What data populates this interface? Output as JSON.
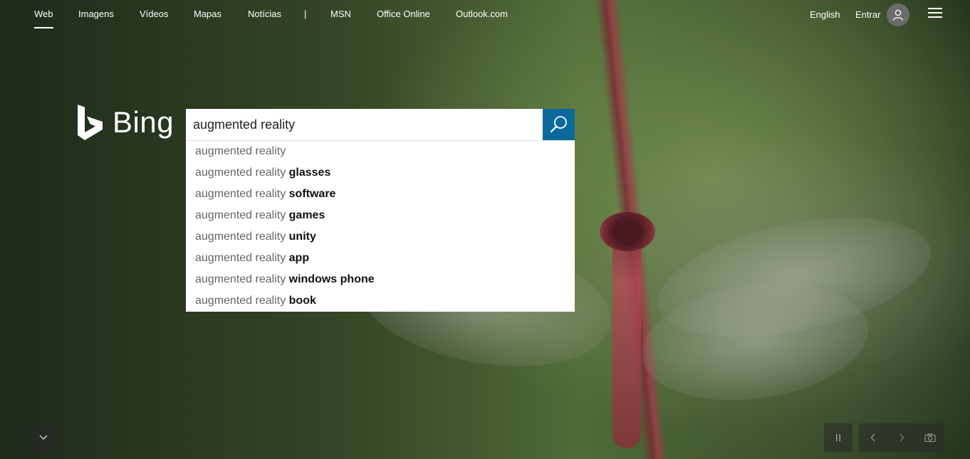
{
  "nav": {
    "items": [
      {
        "label": "Web",
        "active": true
      },
      {
        "label": "Imagens"
      },
      {
        "label": "Vídeos"
      },
      {
        "label": "Mapas"
      },
      {
        "label": "Notícias"
      },
      {
        "label": "|"
      },
      {
        "label": "MSN"
      },
      {
        "label": "Office Online"
      },
      {
        "label": "Outlook.com"
      }
    ],
    "language": "English",
    "signin": "Entrar"
  },
  "logo": {
    "text": "Bing"
  },
  "search": {
    "value": "augmented reality",
    "suggestions": [
      {
        "prefix": "augmented reality",
        "suffix": ""
      },
      {
        "prefix": "augmented reality",
        "suffix": "glasses"
      },
      {
        "prefix": "augmented reality",
        "suffix": "software"
      },
      {
        "prefix": "augmented reality",
        "suffix": "games"
      },
      {
        "prefix": "augmented reality",
        "suffix": "unity"
      },
      {
        "prefix": "augmented reality",
        "suffix": "app"
      },
      {
        "prefix": "augmented reality",
        "suffix": "windows phone"
      },
      {
        "prefix": "augmented reality",
        "suffix": "book"
      }
    ]
  },
  "icons": {
    "search": "search-icon",
    "avatar": "user-icon",
    "menu": "hamburger-menu-icon",
    "scroll": "chevron-down-icon",
    "pause": "pause-icon",
    "prev": "chevron-left-icon",
    "next": "chevron-right-icon",
    "camera": "camera-icon"
  },
  "colors": {
    "search_button": "#0c6a9b"
  }
}
